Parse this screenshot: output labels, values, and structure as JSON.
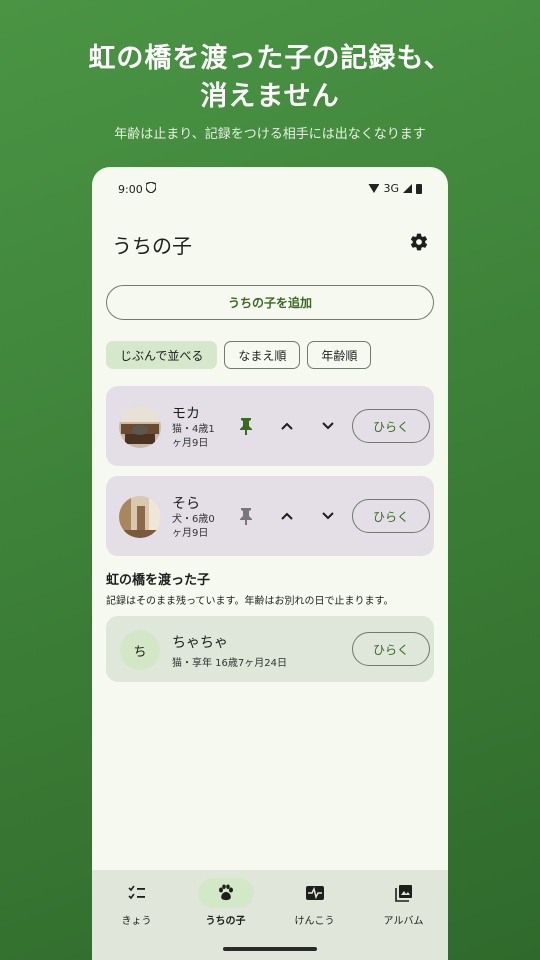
{
  "promo": {
    "headline_line1": "虹の橋を渡った子の記録も、",
    "headline_line2": "消えません",
    "subline": "年齢は止まり、記録をつける相手には出なくなります"
  },
  "status": {
    "time": "9:00",
    "network": "3G"
  },
  "appbar": {
    "title": "うちの子",
    "settings_icon": "gear-icon"
  },
  "add_button": "うちの子を追加",
  "sort_chips": [
    {
      "label": "じぶんで並べる",
      "selected": true
    },
    {
      "label": "なまえ順",
      "selected": false
    },
    {
      "label": "年齢順",
      "selected": false
    }
  ],
  "pets": [
    {
      "name": "モカ",
      "info": "猫・4歳1ヶ月9日",
      "pinned": true,
      "open_label": "ひらく"
    },
    {
      "name": "そら",
      "info": "犬・6歳0ヶ月9日",
      "pinned": false,
      "open_label": "ひらく"
    }
  ],
  "memorial": {
    "title": "虹の橋を渡った子",
    "description": "記録はそのまま残っています。年齢はお別れの日で止まります。",
    "pets": [
      {
        "avatar_letter": "ち",
        "name": "ちゃちゃ",
        "info": "猫・享年 16歳7ヶ月24日",
        "open_label": "ひらく"
      }
    ]
  },
  "nav": [
    {
      "label": "きょう",
      "icon": "checklist-icon",
      "active": false
    },
    {
      "label": "うちの子",
      "icon": "paw-icon",
      "active": true
    },
    {
      "label": "けんこう",
      "icon": "health-monitor-icon",
      "active": false
    },
    {
      "label": "アルバム",
      "icon": "photo-album-icon",
      "active": false
    }
  ],
  "colors": {
    "background": "#3e8239",
    "surface": "#f6f9f0",
    "primary": "#386a20",
    "pet_card": "#e4dfe7",
    "memorial_card": "#dfe6da",
    "selected_chip": "#d5e8cb",
    "bottom_nav": "#e1e6db"
  }
}
